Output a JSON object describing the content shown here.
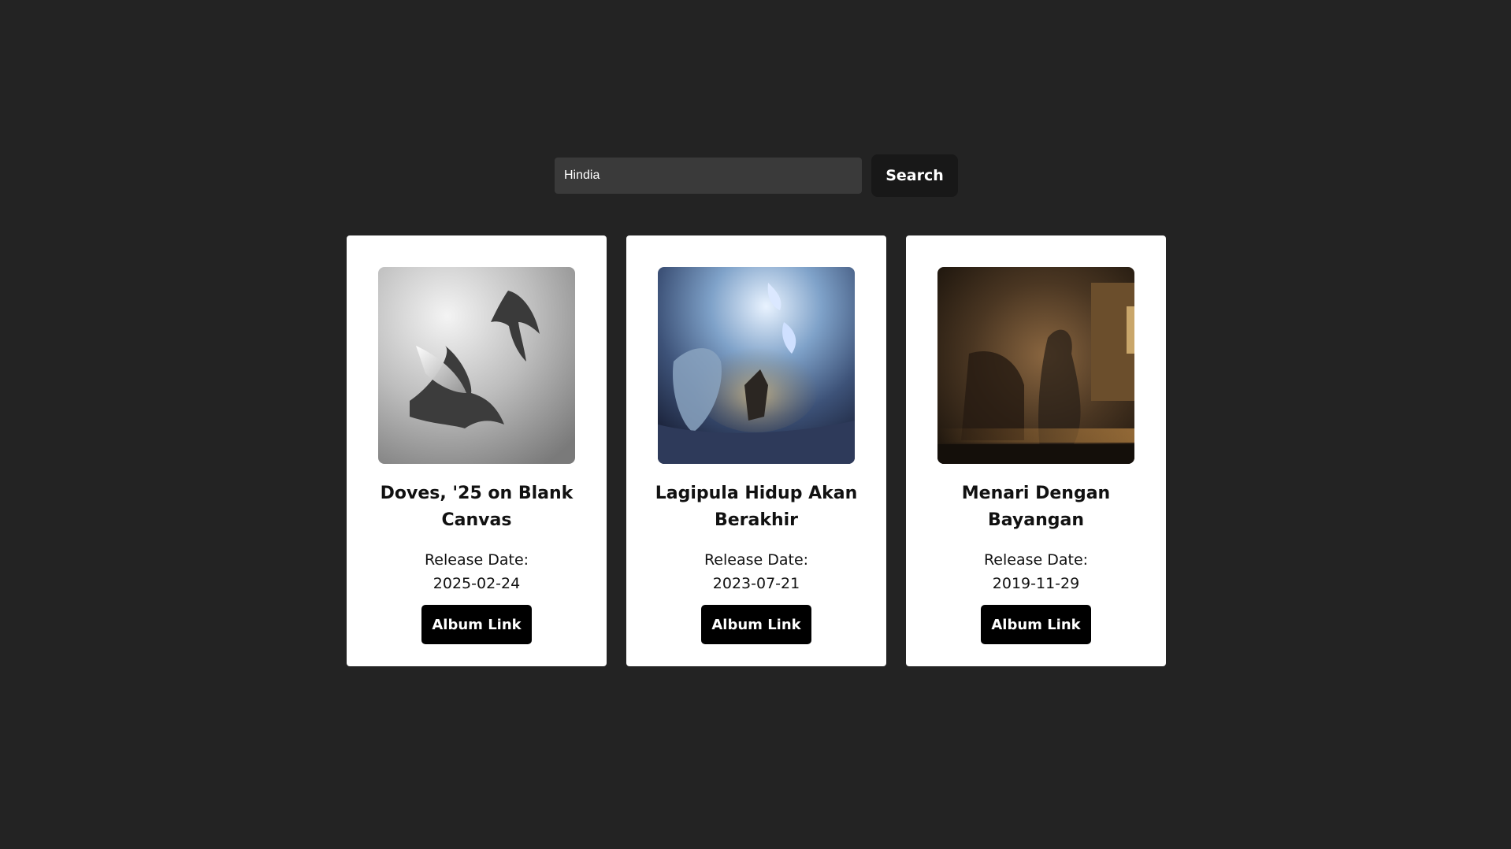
{
  "search": {
    "value": "Hindia",
    "button_label": "Search"
  },
  "albums": [
    {
      "title": "Doves, '25 on Blank Canvas",
      "release_label": "Release Date:",
      "release_date": "2025-02-24",
      "link_label": "Album Link",
      "cover": "doves-in-light-grayscale-image"
    },
    {
      "title": "Lagipula Hidup Akan Berakhir",
      "release_label": "Release Date:",
      "release_date": "2023-07-21",
      "link_label": "Album Link",
      "cover": "angels-in-cave-painting-image"
    },
    {
      "title": "Menari Dengan Bayangan",
      "release_label": "Release Date:",
      "release_date": "2019-11-29",
      "link_label": "Album Link",
      "cover": "dark-smoky-room-photo-image"
    }
  ],
  "colors": {
    "background": "#232323",
    "card": "#ffffff",
    "button": "#000000",
    "input": "#3a3a3a"
  }
}
